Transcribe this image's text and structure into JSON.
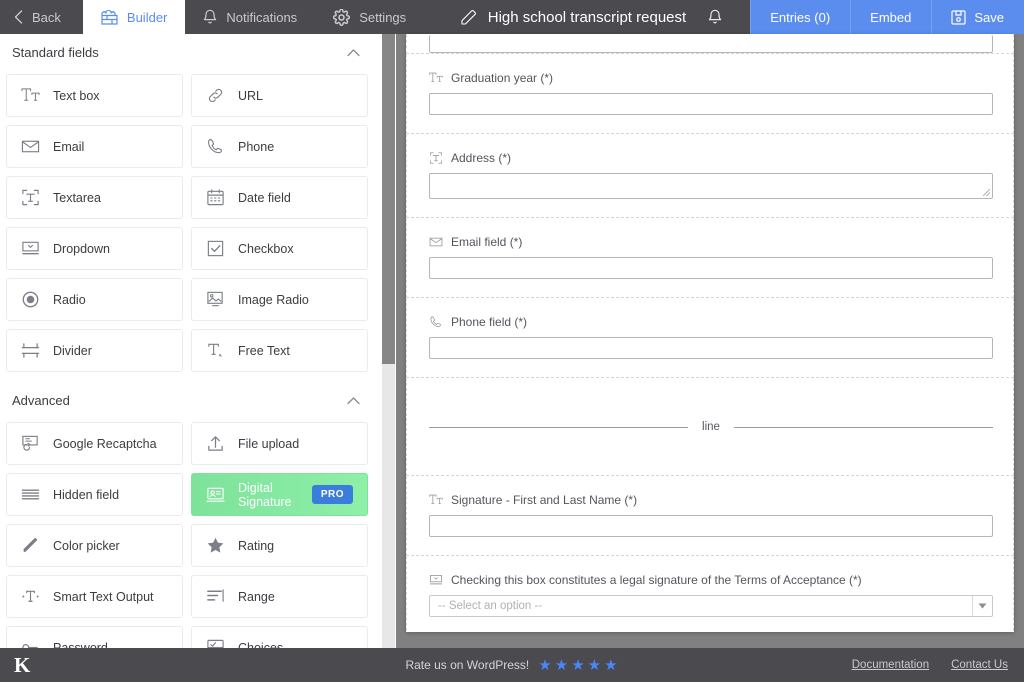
{
  "topbar": {
    "back_label": "Back",
    "tabs": [
      {
        "label": "Builder",
        "icon": "builder-icon",
        "active": true
      },
      {
        "label": "Notifications",
        "icon": "bell-icon",
        "active": false
      },
      {
        "label": "Settings",
        "icon": "gear-icon",
        "active": false
      }
    ],
    "form_title": "High school transcript request",
    "actions": [
      {
        "label": "Entries (0)",
        "icon": ""
      },
      {
        "label": "Embed",
        "icon": ""
      },
      {
        "label": "Save",
        "icon": "save-icon"
      }
    ],
    "accent_blue": "#5b8def",
    "bar_color": "#4a4a4f"
  },
  "sidebar": {
    "sections": [
      {
        "title": "Standard fields",
        "collapsed": false,
        "fields": [
          {
            "label": "Text box",
            "icon": "text-box-icon"
          },
          {
            "label": "URL",
            "icon": "link-icon"
          },
          {
            "label": "Email",
            "icon": "envelope-icon"
          },
          {
            "label": "Phone",
            "icon": "phone-icon"
          },
          {
            "label": "Textarea",
            "icon": "textarea-icon"
          },
          {
            "label": "Date field",
            "icon": "calendar-icon"
          },
          {
            "label": "Dropdown",
            "icon": "dropdown-icon"
          },
          {
            "label": "Checkbox",
            "icon": "checkbox-icon"
          },
          {
            "label": "Radio",
            "icon": "radio-icon"
          },
          {
            "label": "Image Radio",
            "icon": "image-radio-icon"
          },
          {
            "label": "Divider",
            "icon": "divider-icon"
          },
          {
            "label": "Free Text",
            "icon": "free-text-icon"
          }
        ]
      },
      {
        "title": "Advanced",
        "collapsed": false,
        "fields": [
          {
            "label": "Google Recaptcha",
            "icon": "recaptcha-icon"
          },
          {
            "label": "File upload",
            "icon": "upload-icon"
          },
          {
            "label": "Hidden field",
            "icon": "hidden-field-icon"
          },
          {
            "label": "Digital Signature",
            "icon": "signature-icon",
            "pro": true,
            "badge": "PRO"
          },
          {
            "label": "Color picker",
            "icon": "pencil-icon"
          },
          {
            "label": "Rating",
            "icon": "star-icon"
          },
          {
            "label": "Smart Text Output",
            "icon": "smart-text-icon"
          },
          {
            "label": "Range",
            "icon": "range-icon"
          },
          {
            "label": "Password",
            "icon": "key-icon"
          },
          {
            "label": "Choices",
            "icon": "choices-icon"
          }
        ]
      }
    ],
    "pro_badge_color": "#3b7ddd",
    "pro_highlight_color": "#7de29a"
  },
  "canvas": {
    "fields": [
      {
        "type": "text-cut",
        "label": "",
        "icon": ""
      },
      {
        "type": "text",
        "label": "Graduation year (*)",
        "icon": "text-box-icon"
      },
      {
        "type": "textarea",
        "label": "Address (*)",
        "icon": "textarea-icon"
      },
      {
        "type": "email",
        "label": "Email field (*)",
        "icon": "envelope-icon"
      },
      {
        "type": "phone",
        "label": "Phone field (*)",
        "icon": "phone-icon"
      },
      {
        "type": "divider",
        "label": "line",
        "icon": "divider-icon"
      },
      {
        "type": "text",
        "label": "Signature - First and Last Name (*)",
        "icon": "text-box-icon"
      },
      {
        "type": "select",
        "label": "Checking this box constitutes a legal signature of the Terms of Acceptance (*)",
        "icon": "dropdown-icon",
        "placeholder": "-- Select an option --"
      }
    ]
  },
  "footer": {
    "logo": "K",
    "rate_text": "Rate us on WordPress!",
    "stars": 5,
    "star_color": "#4a86f7",
    "links": [
      {
        "label": "Documentation"
      },
      {
        "label": "Contact Us"
      }
    ]
  }
}
